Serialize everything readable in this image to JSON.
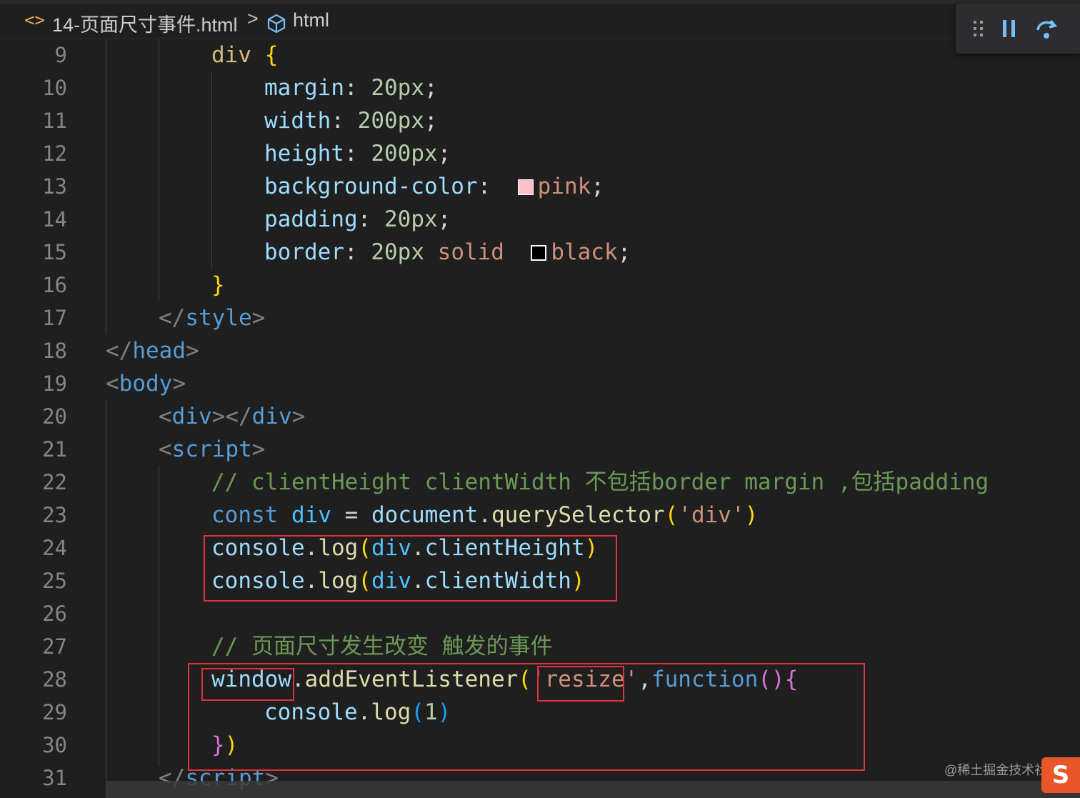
{
  "breadcrumb": {
    "code_icon": "code-brackets-icon",
    "file": "14-页面尺寸事件.html",
    "separator": ">",
    "symbol_icon": "cube-icon",
    "symbol": "html"
  },
  "debug_toolbar": {
    "grip_icon": "drag-grip-icon",
    "pause_icon": "pause-icon",
    "step_icon": "step-over-icon"
  },
  "line_numbers": [
    "9",
    "10",
    "11",
    "12",
    "13",
    "14",
    "15",
    "16",
    "17",
    "18",
    "19",
    "20",
    "21",
    "22",
    "23",
    "24",
    "25",
    "26",
    "27",
    "28",
    "29",
    "30",
    "31"
  ],
  "code": {
    "l9": {
      "sel": "div",
      "brace": "{"
    },
    "l10": {
      "prop": "margin",
      "colon": ":",
      "value": "20px",
      "semi": ";"
    },
    "l11": {
      "prop": "width",
      "colon": ":",
      "value": "200px",
      "semi": ";"
    },
    "l12": {
      "prop": "height",
      "colon": ":",
      "value": "200px",
      "semi": ";"
    },
    "l13": {
      "prop": "background-color",
      "colon": ":",
      "value": "pink",
      "semi": ";"
    },
    "l14": {
      "prop": "padding",
      "colon": ":",
      "value": "20px",
      "semi": ";"
    },
    "l15": {
      "prop": "border",
      "colon": ":",
      "value1": "20px",
      "value2": "solid",
      "value3": "black",
      "semi": ";"
    },
    "l16": {
      "brace": "}"
    },
    "l17": {
      "open": "</",
      "tag": "style",
      "close": ">"
    },
    "l18": {
      "open": "</",
      "tag": "head",
      "close": ">"
    },
    "l19": {
      "open": "<",
      "tag": "body",
      "close": ">"
    },
    "l20": {
      "a": "<",
      "tag1": "div",
      "b": "></",
      "tag2": "div",
      "c": ">"
    },
    "l21": {
      "open": "<",
      "tag": "script",
      "close": ">"
    },
    "l22": {
      "comment": "// clientHeight clientWidth 不包括border margin ,包括padding"
    },
    "l23": {
      "kw": "const",
      "var": "div",
      "eq": "=",
      "obj": "document",
      "dot": ".",
      "fn": "querySelector",
      "p1": "(",
      "str": "'div'",
      "p2": ")"
    },
    "l24": {
      "obj": "console",
      "dot": ".",
      "fn": "log",
      "p1": "(",
      "var": "div",
      "dot2": ".",
      "prop": "clientHeight",
      "p2": ")"
    },
    "l25": {
      "obj": "console",
      "dot": ".",
      "fn": "log",
      "p1": "(",
      "var": "div",
      "dot2": ".",
      "prop": "clientWidth",
      "p2": ")"
    },
    "l27": {
      "comment": "// 页面尺寸发生改变 触发的事件"
    },
    "l28": {
      "obj": "window",
      "dot": ".",
      "fn": "addEventListener",
      "p1": "(",
      "q1": "'",
      "str": "resize",
      "q2": "'",
      "comma": ",",
      "kw": "function",
      "p2": "()",
      "brace": "{"
    },
    "l29": {
      "obj": "console",
      "dot": ".",
      "fn": "log",
      "p1": "(",
      "num": "1",
      "p2": ")"
    },
    "l30": {
      "brace": "}",
      "paren": ")"
    },
    "l31": {
      "open": "</",
      "tag": "script",
      "close": ">"
    }
  },
  "colors": {
    "background": "#1f1f1f",
    "highlight_box": "#e0323a"
  },
  "watermark": {
    "text": "@稀土掘金技术社区",
    "logo": "S"
  }
}
